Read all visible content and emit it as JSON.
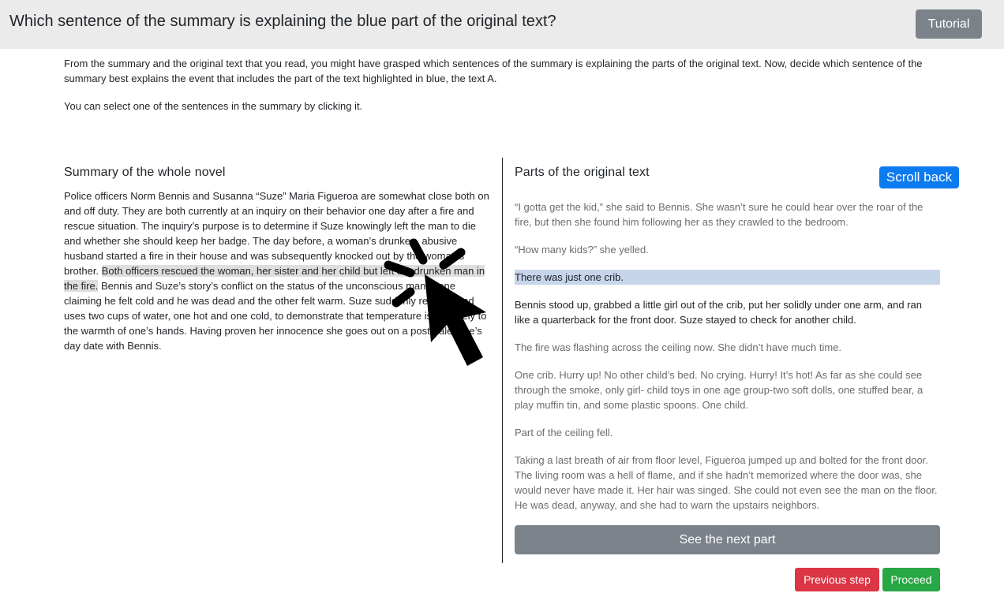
{
  "header": {
    "title": "Which sentence of the summary is explaining the blue part of the original text?",
    "tutorial_label": "Tutorial"
  },
  "intro": {
    "paragraph1": "From the summary and the original text that you read, you might have grasped which sentences of the summary is explaining the parts of the original text. Now, decide which sentence of the summary best explains the event that includes the part of the text highlighted in blue, the text A.",
    "paragraph2": "You can select one of the sentences in the summary by clicking it."
  },
  "summary": {
    "heading": "Summary of the whole novel",
    "sentences": [
      "Police officers Norm Bennis and Susanna “Suze” Maria Figueroa are somewhat close both on and off duty.",
      " They are both currently at an inquiry on their behavior one day after a fire and rescue situation.",
      " The inquiry’s purpose is to determine if Suze knowingly left the man to die and whether she should keep her badge.",
      " The day before, a woman’s drunken, abusive husband started a fire in their house and was subsequently knocked out by the woman’s brother.",
      " ",
      "Both officers rescued the woman, her sister and her child but left the drunken man in the fire.",
      " Bennis and Suze’s story’s conflict on the status of the unconscious man -- one claiming he felt cold and he was dead and the other felt warm.",
      " Suze suddenly realizes and uses two cups of water, one hot and one cold, to demonstrate that temperature is relatively to the warmth of one’s hands.",
      " Having proven her innocence she goes out on a post Valentine’s day date with Bennis."
    ]
  },
  "original": {
    "heading": "Parts of the original text",
    "scroll_back_label": "Scroll back",
    "paragraphs": [
      "“I gotta get the kid,” she said to Bennis. She wasn’t sure he could hear over the roar of the fire, but then she found him following her as they crawled to the bedroom.",
      "“How many kids?” she yelled.",
      "There was just one crib.",
      "Bennis stood up, grabbed a little girl out of the crib, put her solidly under one arm, and ran like a quarterback for the front door. Suze stayed to check for another child.",
      "The fire was flashing across the ceiling now. She didn’t have much time.",
      "One crib. Hurry up! No other child’s bed. No crying. Hurry! It’s hot! As far as she could see through the smoke, only girl- child toys in one age group-two soft dolls, one stuffed bear, a play muffin tin, and some plastic spoons. One child.",
      "Part of the ceiling fell.",
      "Taking a last breath of air from floor level, Figueroa jumped up and bolted for the front door. The living room was a hell of flame, and if she hadn’t memorized where the door was, she would never have made it. Her hair was singed. She could not even see the man on the floor. He was dead, anyway, and she had to warn the upstairs neighbors."
    ]
  },
  "footer": {
    "next_part_label": "See the next part",
    "previous_label": "Previous step",
    "proceed_label": "Proceed"
  },
  "colors": {
    "highlight_blue": "#c6d5ea",
    "highlight_grey": "#dedede",
    "button_grey": "#7b8289",
    "button_blue": "#0d7bf0",
    "button_red": "#dc3545",
    "button_green": "#28a745"
  },
  "icons": {
    "cursor": "mouse-pointer-click-icon"
  }
}
